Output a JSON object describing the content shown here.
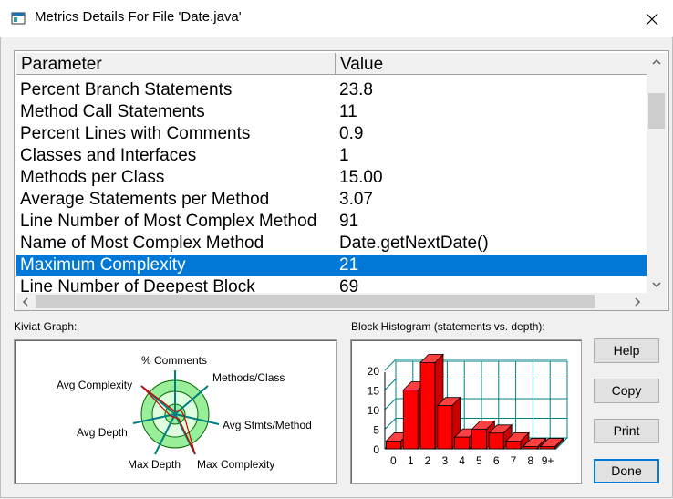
{
  "window": {
    "title": "Metrics Details For File 'Date.java'"
  },
  "list": {
    "headers": [
      "Parameter",
      "Value"
    ],
    "rows": [
      {
        "param": "Percent Branch Statements",
        "value": "23.8"
      },
      {
        "param": "Method Call Statements",
        "value": "11"
      },
      {
        "param": "Percent Lines with Comments",
        "value": "0.9"
      },
      {
        "param": "Classes and Interfaces",
        "value": "1"
      },
      {
        "param": "Methods per Class",
        "value": "15.00"
      },
      {
        "param": "Average Statements per Method",
        "value": "3.07"
      },
      {
        "param": "Line Number of Most Complex Method",
        "value": "91"
      },
      {
        "param": "Name of Most Complex Method",
        "value": "Date.getNextDate()"
      },
      {
        "param": "Maximum Complexity",
        "value": "21"
      },
      {
        "param": "Line Number of Deepest Block",
        "value": "69"
      }
    ],
    "selected_index": 8
  },
  "kiviat": {
    "label": "Kiviat Graph:",
    "axes": [
      "% Comments",
      "Methods/Class",
      "Avg Stmts/Method",
      "Max Complexity",
      "Max Depth",
      "Avg Depth",
      "Avg Complexity"
    ],
    "colors": {
      "outer_ring": "#99ee99",
      "inner_ring": "#ddffdd",
      "axis": "#008080",
      "plot_line": "#cc0000"
    }
  },
  "histogram": {
    "label": "Block Histogram (statements vs. depth):",
    "bar_color": "#ff0000",
    "grid_color": "#008080"
  },
  "buttons": {
    "help": "Help",
    "copy": "Copy",
    "print": "Print",
    "done": "Done"
  },
  "chart_data": {
    "type": "bar",
    "title": "Block Histogram (statements vs. depth):",
    "categories": [
      "0",
      "1",
      "2",
      "3",
      "4",
      "5",
      "6",
      "7",
      "8",
      "9+"
    ],
    "values": [
      2,
      15,
      22,
      11,
      3,
      5,
      4,
      2,
      0,
      0
    ],
    "ylim": [
      0,
      20
    ],
    "yticks": [
      "0",
      "5",
      "10",
      "15",
      "20"
    ],
    "grid": true
  }
}
